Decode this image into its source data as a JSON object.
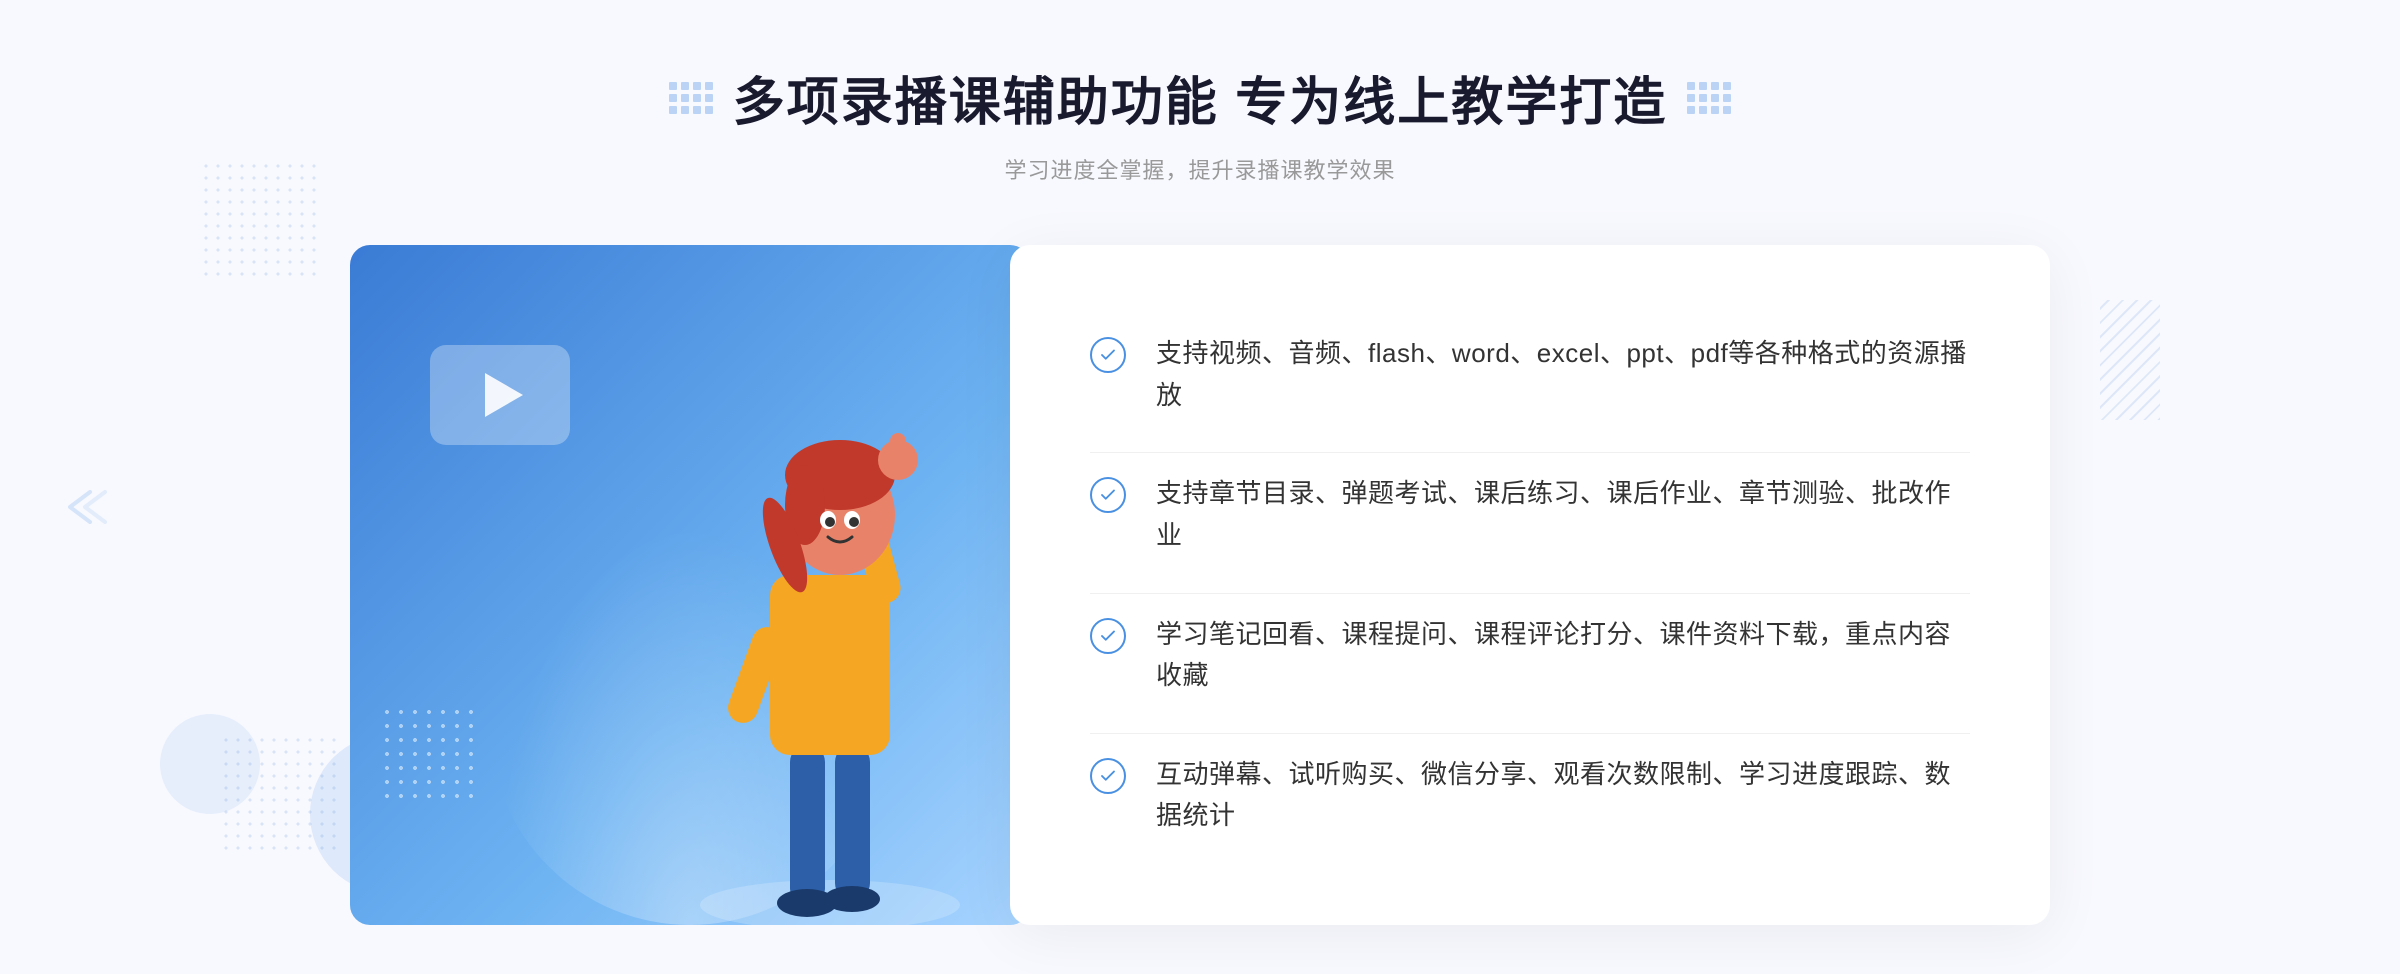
{
  "header": {
    "main_title": "多项录播课辅助功能 专为线上教学打造",
    "subtitle": "学习进度全掌握，提升录播课教学效果"
  },
  "features": [
    {
      "id": 1,
      "text": "支持视频、音频、flash、word、excel、ppt、pdf等各种格式的资源播放"
    },
    {
      "id": 2,
      "text": "支持章节目录、弹题考试、课后练习、课后作业、章节测验、批改作业"
    },
    {
      "id": 3,
      "text": "学习笔记回看、课程提问、课程评论打分、课件资料下载，重点内容收藏"
    },
    {
      "id": 4,
      "text": "互动弹幕、试听购买、微信分享、观看次数限制、学习进度跟踪、数据统计"
    }
  ],
  "colors": {
    "primary_blue": "#4a90e2",
    "dark_text": "#1a1a2e",
    "light_gray": "#999999",
    "white": "#ffffff"
  },
  "icons": {
    "check": "check-circle-icon",
    "play": "play-icon",
    "chevron": "chevron-icon"
  }
}
